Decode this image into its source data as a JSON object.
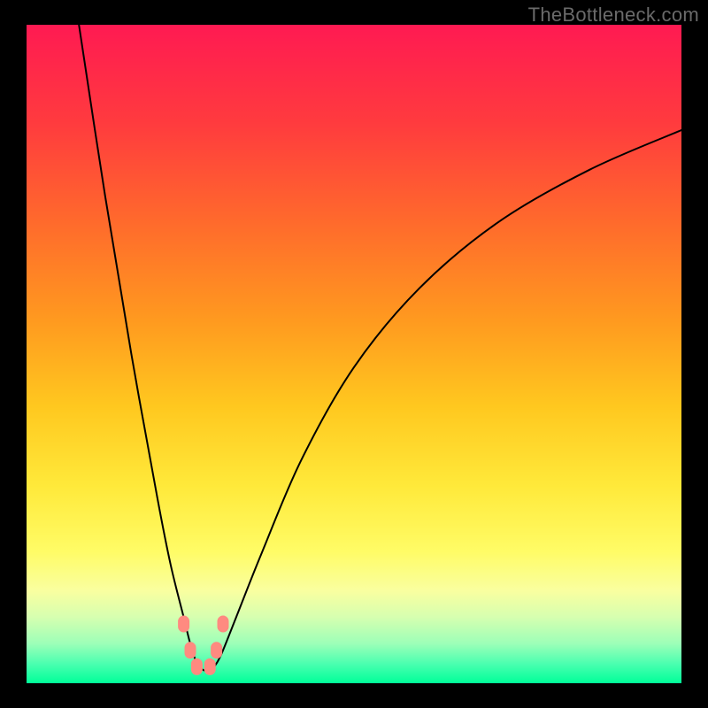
{
  "watermark": "TheBottleneck.com",
  "colors": {
    "background": "#000000",
    "gradient_top": "#ff1a52",
    "gradient_bottom": "#00ff99",
    "curve_stroke": "#000000",
    "marker": "#ff8a80"
  },
  "chart_data": {
    "type": "line",
    "title": "",
    "xlabel": "",
    "ylabel": "",
    "xlim": [
      0,
      100
    ],
    "ylim": [
      0,
      100
    ],
    "series": [
      {
        "name": "bottleneck-curve",
        "x": [
          8,
          12,
          16,
          20,
          22,
          24,
          25,
          26,
          27,
          28,
          29,
          30,
          32,
          36,
          42,
          50,
          60,
          72,
          86,
          100
        ],
        "y": [
          100,
          74,
          50,
          28,
          18,
          10,
          6,
          3,
          2,
          2,
          3,
          5,
          10,
          20,
          34,
          48,
          60,
          70,
          78,
          84
        ]
      }
    ],
    "markers": [
      {
        "x": 24.0,
        "y": 9
      },
      {
        "x": 25.0,
        "y": 5
      },
      {
        "x": 26.0,
        "y": 2.5
      },
      {
        "x": 28.0,
        "y": 2.5
      },
      {
        "x": 29.0,
        "y": 5
      },
      {
        "x": 30.0,
        "y": 9
      }
    ]
  }
}
